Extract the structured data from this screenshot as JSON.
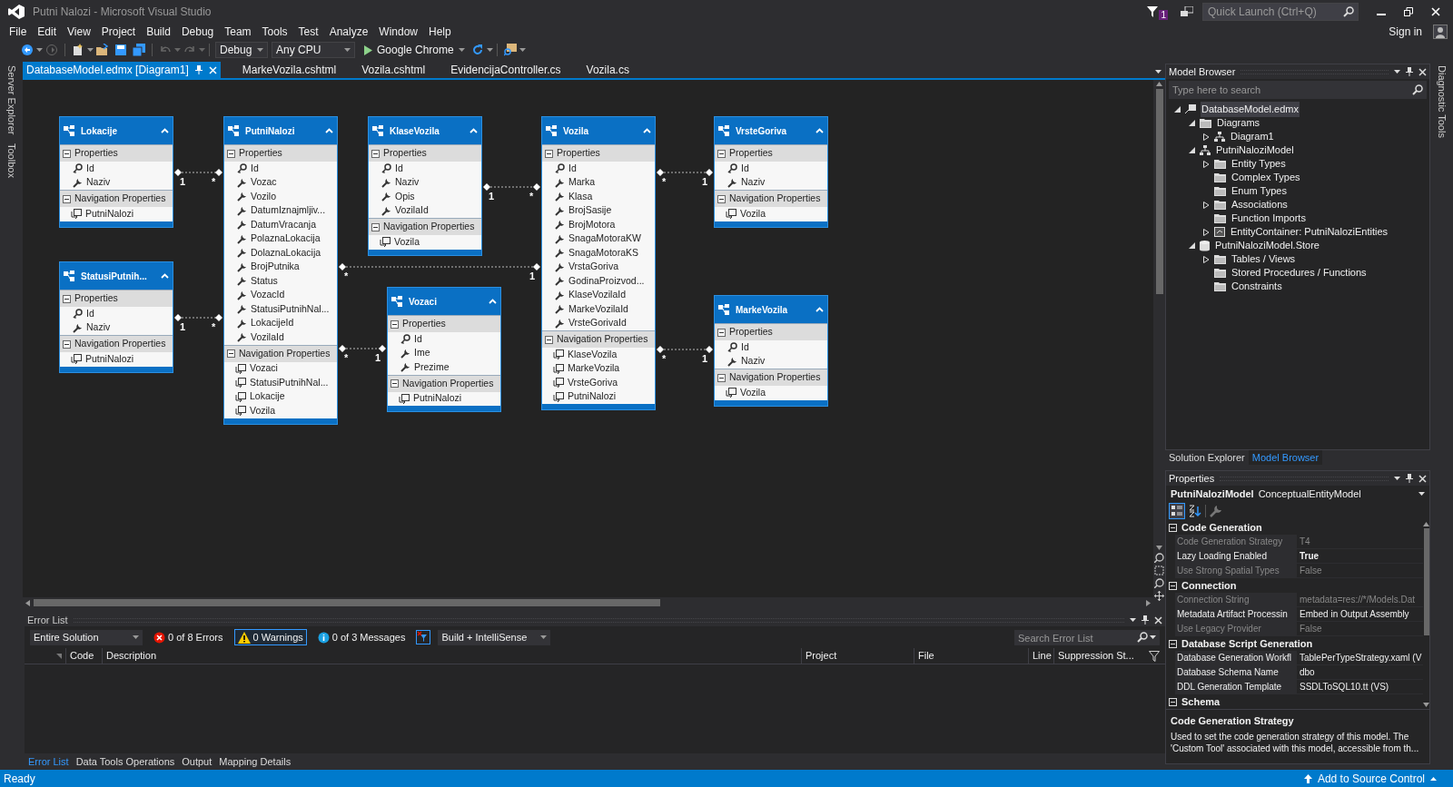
{
  "window": {
    "title": "Putni Nalozi - Microsoft Visual Studio"
  },
  "notification_badge": "1",
  "quick_launch": {
    "placeholder": "Quick Launch (Ctrl+Q)"
  },
  "menu": [
    "File",
    "Edit",
    "View",
    "Project",
    "Build",
    "Debug",
    "Team",
    "Tools",
    "Test",
    "Analyze",
    "Window",
    "Help"
  ],
  "sign_in": "Sign in",
  "toolbar": {
    "configuration": "Debug",
    "platform": "Any CPU",
    "run_target": "Google Chrome"
  },
  "side_tabs_left": [
    "Server Explorer",
    "Toolbox"
  ],
  "side_tabs_right": [
    "Diagnostic Tools"
  ],
  "document_tabs": [
    {
      "label": "DatabaseModel.edmx [Diagram1]",
      "selected": true
    },
    {
      "label": "MarkeVozila.cshtml",
      "selected": false
    },
    {
      "label": "Vozila.cshtml",
      "selected": false
    },
    {
      "label": "EvidencijaController.cs",
      "selected": false
    },
    {
      "label": "Vozila.cs",
      "selected": false
    }
  ],
  "diagram": {
    "entities": [
      {
        "name": "Lokacije",
        "sections": [
          {
            "kind": "scalar",
            "title": "Properties",
            "items": [
              {
                "name": "Id",
                "key": true
              },
              {
                "name": "Naziv",
                "key": false
              }
            ]
          },
          {
            "kind": "navigation",
            "title": "Navigation Properties",
            "items": [
              {
                "name": "PutniNalozi"
              }
            ]
          }
        ]
      },
      {
        "name": "PutniNalozi",
        "sections": [
          {
            "kind": "scalar",
            "title": "Properties",
            "items": [
              {
                "name": "Id",
                "key": true
              },
              {
                "name": "Vozac",
                "key": false
              },
              {
                "name": "Vozilo",
                "key": false
              },
              {
                "name": "DatumIznajmljiv...",
                "key": false
              },
              {
                "name": "DatumVracanja",
                "key": false
              },
              {
                "name": "PolaznaLokacija",
                "key": false
              },
              {
                "name": "DolaznaLokacija",
                "key": false
              },
              {
                "name": "BrojPutnika",
                "key": false
              },
              {
                "name": "Status",
                "key": false
              },
              {
                "name": "VozacId",
                "key": false
              },
              {
                "name": "StatusiPutnihNal...",
                "key": false
              },
              {
                "name": "LokacijeId",
                "key": false
              },
              {
                "name": "VozilaId",
                "key": false
              }
            ]
          },
          {
            "kind": "navigation",
            "title": "Navigation Properties",
            "items": [
              {
                "name": "Vozaci"
              },
              {
                "name": "StatusiPutnihNal..."
              },
              {
                "name": "Lokacije"
              },
              {
                "name": "Vozila"
              }
            ]
          }
        ]
      },
      {
        "name": "KlaseVozila",
        "sections": [
          {
            "kind": "scalar",
            "title": "Properties",
            "items": [
              {
                "name": "Id",
                "key": true
              },
              {
                "name": "Naziv",
                "key": false
              },
              {
                "name": "Opis",
                "key": false
              },
              {
                "name": "VozilaId",
                "key": false
              }
            ]
          },
          {
            "kind": "navigation",
            "title": "Navigation Properties",
            "items": [
              {
                "name": "Vozila"
              }
            ]
          }
        ]
      },
      {
        "name": "Vozila",
        "sections": [
          {
            "kind": "scalar",
            "title": "Properties",
            "items": [
              {
                "name": "Id",
                "key": true
              },
              {
                "name": "Marka",
                "key": false
              },
              {
                "name": "Klasa",
                "key": false
              },
              {
                "name": "BrojSasije",
                "key": false
              },
              {
                "name": "BrojMotora",
                "key": false
              },
              {
                "name": "SnagaMotoraKW",
                "key": false
              },
              {
                "name": "SnagaMotoraKS",
                "key": false
              },
              {
                "name": "VrstaGoriva",
                "key": false
              },
              {
                "name": "GodinaProizvod...",
                "key": false
              },
              {
                "name": "KlaseVozilaId",
                "key": false
              },
              {
                "name": "MarkeVozilaId",
                "key": false
              },
              {
                "name": "VrsteGorivaId",
                "key": false
              }
            ]
          },
          {
            "kind": "navigation",
            "title": "Navigation Properties",
            "items": [
              {
                "name": "KlaseVozila"
              },
              {
                "name": "MarkeVozila"
              },
              {
                "name": "VrsteGoriva"
              },
              {
                "name": "PutniNalozi"
              }
            ]
          }
        ]
      },
      {
        "name": "VrsteGoriva",
        "sections": [
          {
            "kind": "scalar",
            "title": "Properties",
            "items": [
              {
                "name": "Id",
                "key": true
              },
              {
                "name": "Naziv",
                "key": false
              }
            ]
          },
          {
            "kind": "navigation",
            "title": "Navigation Properties",
            "items": [
              {
                "name": "Vozila"
              }
            ]
          }
        ]
      },
      {
        "name": "StatusiPutnih...",
        "sections": [
          {
            "kind": "scalar",
            "title": "Properties",
            "items": [
              {
                "name": "Id",
                "key": true
              },
              {
                "name": "Naziv",
                "key": false
              }
            ]
          },
          {
            "kind": "navigation",
            "title": "Navigation Properties",
            "items": [
              {
                "name": "PutniNalozi"
              }
            ]
          }
        ]
      },
      {
        "name": "Vozaci",
        "sections": [
          {
            "kind": "scalar",
            "title": "Properties",
            "items": [
              {
                "name": "Id",
                "key": true
              },
              {
                "name": "Ime",
                "key": false
              },
              {
                "name": "Prezime",
                "key": false
              }
            ]
          },
          {
            "kind": "navigation",
            "title": "Navigation Properties",
            "items": [
              {
                "name": "PutniNalozi"
              }
            ]
          }
        ]
      },
      {
        "name": "MarkeVozila",
        "sections": [
          {
            "kind": "scalar",
            "title": "Properties",
            "items": [
              {
                "name": "Id",
                "key": true
              },
              {
                "name": "Naziv",
                "key": false
              }
            ]
          },
          {
            "kind": "navigation",
            "title": "Navigation Properties",
            "items": [
              {
                "name": "Vozila"
              }
            ]
          }
        ]
      }
    ],
    "associations": [
      {
        "end1": "1",
        "end2": "*"
      },
      {
        "end1": "1",
        "end2": "*"
      },
      {
        "end1": "1",
        "end2": "*"
      },
      {
        "end1": "*",
        "end2": "1"
      },
      {
        "end1": "*",
        "end2": "1"
      },
      {
        "end1": "*",
        "end2": "1"
      },
      {
        "end1": "*",
        "end2": "1"
      }
    ]
  },
  "model_browser": {
    "title": "Model Browser",
    "search": {
      "placeholder": "Type here to search"
    },
    "tree": [
      {
        "label": "DatabaseModel.edmx",
        "kind": "edmx",
        "expanded": true,
        "selected": true,
        "children": [
          {
            "label": "Diagrams",
            "kind": "folder",
            "expanded": true,
            "selected": false,
            "children": [
              {
                "label": "Diagram1",
                "kind": "diagram",
                "expanded": false,
                "selected": false
              }
            ]
          },
          {
            "label": "PutniNaloziModel",
            "kind": "diagram",
            "expanded": true,
            "selected": false,
            "children": [
              {
                "label": "Entity Types",
                "kind": "folder",
                "expanded": false,
                "selected": false
              },
              {
                "label": "Complex Types",
                "kind": "folder",
                "selected": false
              },
              {
                "label": "Enum Types",
                "kind": "folder",
                "selected": false
              },
              {
                "label": "Associations",
                "kind": "folder",
                "expanded": false,
                "selected": false
              },
              {
                "label": "Function Imports",
                "kind": "folder",
                "selected": false
              },
              {
                "label": "EntityContainer: PutniNaloziEntities",
                "kind": "container",
                "expanded": false,
                "selected": false
              }
            ]
          },
          {
            "label": "PutniNaloziModel.Store",
            "kind": "database",
            "expanded": true,
            "selected": false,
            "children": [
              {
                "label": "Tables / Views",
                "kind": "folder",
                "expanded": false,
                "selected": false
              },
              {
                "label": "Stored Procedures / Functions",
                "kind": "folder",
                "selected": false
              },
              {
                "label": "Constraints",
                "kind": "folder",
                "selected": false
              }
            ]
          }
        ]
      }
    ]
  },
  "panel_tabs": [
    {
      "label": "Solution Explorer",
      "selected": false
    },
    {
      "label": "Model Browser",
      "selected": true
    }
  ],
  "properties": {
    "title": "Properties",
    "object_name": "PutniNaloziModel",
    "object_type": "ConceptualEntityModel",
    "categories": [
      {
        "name": "Code Generation",
        "expanded": true,
        "rows": [
          {
            "name": "Code Generation Strategy",
            "value": "T4",
            "readonly": true,
            "modified": false
          },
          {
            "name": "Lazy Loading Enabled",
            "value": "True",
            "readonly": false,
            "modified": true
          },
          {
            "name": "Use Strong Spatial Types",
            "value": "False",
            "readonly": true,
            "modified": false
          }
        ]
      },
      {
        "name": "Connection",
        "expanded": true,
        "rows": [
          {
            "name": "Connection String",
            "value": "metadata=res://*/Models.Dat",
            "readonly": true,
            "modified": false
          },
          {
            "name": "Metadata Artifact Processin",
            "value": "Embed in Output Assembly",
            "readonly": false,
            "modified": false
          },
          {
            "name": "Use Legacy Provider",
            "value": "False",
            "readonly": true,
            "modified": false
          }
        ]
      },
      {
        "name": "Database Script Generation",
        "expanded": true,
        "rows": [
          {
            "name": "Database Generation Workfl",
            "value": "TablePerTypeStrategy.xaml (V",
            "readonly": false,
            "modified": false
          },
          {
            "name": "Database Schema Name",
            "value": "dbo",
            "readonly": false,
            "modified": false
          },
          {
            "name": "DDL Generation Template",
            "value": "SSDLToSQL10.tt (VS)",
            "readonly": false,
            "modified": false
          }
        ]
      },
      {
        "name": "Schema",
        "expanded": true
      }
    ],
    "description": {
      "title": "Code Generation Strategy",
      "text": "Used to set the code generation strategy of this model. The 'Custom Tool' associated with this model, accessible from th..."
    }
  },
  "error_list": {
    "title": "Error List",
    "scope": "Entire Solution",
    "filters": [
      {
        "kind": "errors",
        "label": "0 of 8 Errors",
        "selected": false
      },
      {
        "kind": "warnings",
        "label": "0 Warnings",
        "selected": true
      },
      {
        "kind": "messages",
        "label": "0 of 3 Messages",
        "selected": false
      }
    ],
    "source": "Build + IntelliSense",
    "search": {
      "placeholder": "Search Error List"
    },
    "columns": [
      "Code",
      "Description",
      "Project",
      "File",
      "Line",
      "Suppression St..."
    ]
  },
  "bottom_tabs": [
    {
      "label": "Error List",
      "selected": true
    },
    {
      "label": "Data Tools Operations",
      "selected": false
    },
    {
      "label": "Output",
      "selected": false
    },
    {
      "label": "Mapping Details",
      "selected": false
    }
  ],
  "status_bar": {
    "text": "Ready",
    "source_control": "Add to Source Control"
  }
}
